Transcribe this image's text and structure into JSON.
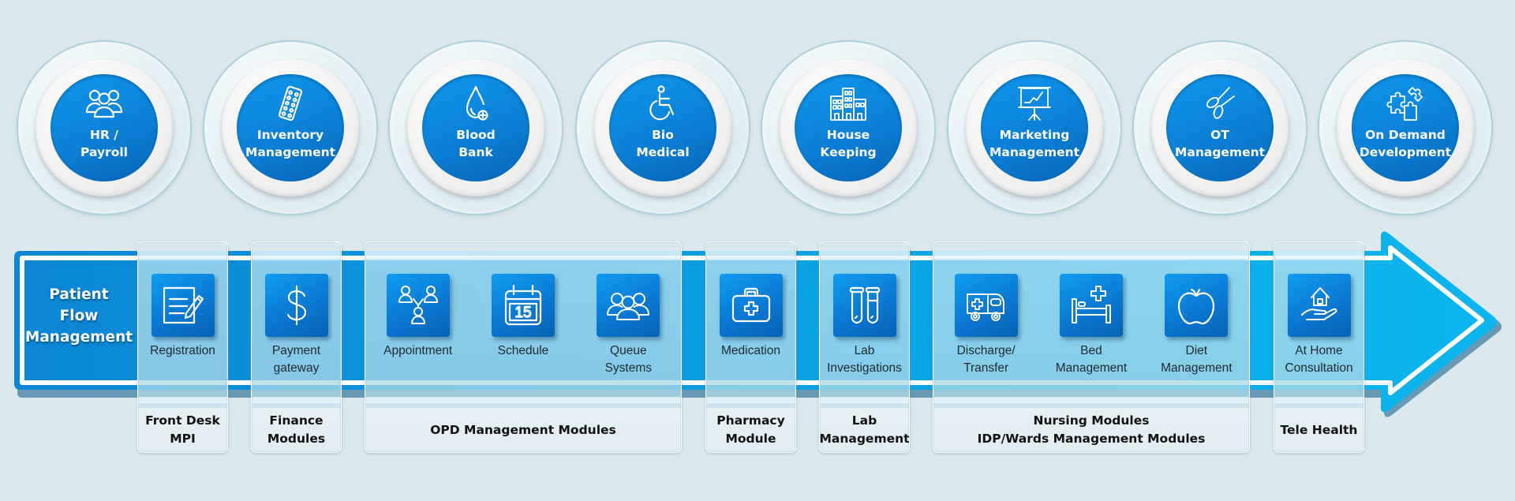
{
  "top_modules": [
    {
      "line1": "HR /",
      "line2": "Payroll",
      "icon": "people-group-icon"
    },
    {
      "line1": "Inventory",
      "line2": "Management",
      "icon": "pill-blister-icon"
    },
    {
      "line1": "Blood",
      "line2": "Bank",
      "icon": "blood-drop-icon"
    },
    {
      "line1": "Bio",
      "line2": "Medical",
      "icon": "wheelchair-icon"
    },
    {
      "line1": "House",
      "line2": "Keeping",
      "icon": "buildings-icon"
    },
    {
      "line1": "Marketing",
      "line2": "Management",
      "icon": "presentation-chart-icon"
    },
    {
      "line1": "OT",
      "line2": "Management",
      "icon": "scissors-icon"
    },
    {
      "line1": "On Demand",
      "line2": "Development",
      "icon": "puzzle-icon"
    }
  ],
  "flow": {
    "title_lines": [
      "Patient",
      "Flow",
      "Management"
    ],
    "colors": {
      "arrow": "#0aa6e6",
      "tile": "#0b80d6",
      "disc": "#0b80d6"
    }
  },
  "panels": [
    {
      "group_lines": [
        "Front Desk",
        "MPI"
      ],
      "items": [
        {
          "lines": [
            "Registration",
            ""
          ],
          "icon": "registration-form-icon"
        }
      ]
    },
    {
      "group_lines": [
        "Finance",
        "Modules"
      ],
      "items": [
        {
          "lines": [
            "Payment",
            "gateway"
          ],
          "icon": "dollar-icon"
        }
      ]
    },
    {
      "group_lines": [
        "OPD Management Modules",
        ""
      ],
      "items": [
        {
          "lines": [
            "Appointment",
            ""
          ],
          "icon": "people-network-icon"
        },
        {
          "lines": [
            "Schedule",
            ""
          ],
          "icon": "calendar-icon",
          "calendar_day": "15"
        },
        {
          "lines": [
            "Queue",
            "Systems"
          ],
          "icon": "people-group-icon"
        }
      ]
    },
    {
      "group_lines": [
        "Pharmacy",
        "Module"
      ],
      "items": [
        {
          "lines": [
            "Medication",
            ""
          ],
          "icon": "medical-kit-icon"
        }
      ]
    },
    {
      "group_lines": [
        "Lab",
        "Management"
      ],
      "items": [
        {
          "lines": [
            "Lab",
            "Investigations"
          ],
          "icon": "test-tubes-icon"
        }
      ]
    },
    {
      "group_lines": [
        "Nursing Modules",
        "IDP/Wards Management Modules"
      ],
      "items": [
        {
          "lines": [
            "Discharge/",
            "Transfer"
          ],
          "icon": "ambulance-icon"
        },
        {
          "lines": [
            "Bed",
            "Management"
          ],
          "icon": "hospital-bed-icon"
        },
        {
          "lines": [
            "Diet",
            "Management"
          ],
          "icon": "apple-icon"
        }
      ]
    },
    {
      "group_lines": [
        "Tele Health",
        ""
      ],
      "items": [
        {
          "lines": [
            "At Home",
            "Consultation"
          ],
          "icon": "home-care-icon"
        }
      ]
    }
  ]
}
